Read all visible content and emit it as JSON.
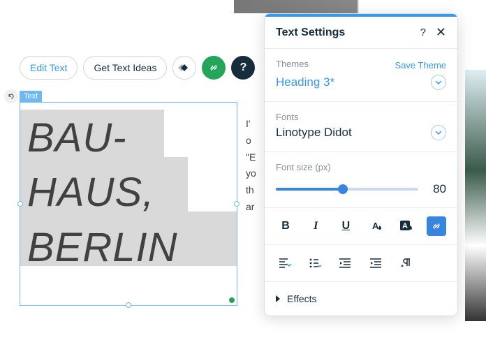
{
  "toolbar": {
    "edit_text": "Edit Text",
    "get_ideas": "Get Text Ideas"
  },
  "selection": {
    "label": "Text",
    "content": "BAU-\nHAUS,\nBERLIN"
  },
  "paragraph_peek": [
    "I'",
    "o",
    "\"E",
    "yo",
    "th",
    "ar"
  ],
  "panel": {
    "title": "Text Settings",
    "themes": {
      "label": "Themes",
      "save": "Save Theme",
      "value": "Heading 3*"
    },
    "fonts": {
      "label": "Fonts",
      "value": "Linotype Didot"
    },
    "fontsize": {
      "label": "Font size (px)",
      "value": "80"
    },
    "effects": "Effects"
  }
}
